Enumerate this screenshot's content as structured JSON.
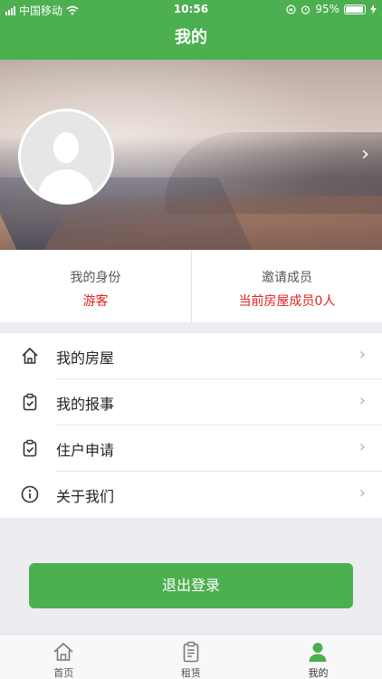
{
  "status_bar": {
    "carrier": "中国移动",
    "time": "10:56",
    "battery_percent": "95%",
    "battery_level": 0.95
  },
  "nav": {
    "title": "我的"
  },
  "identity": {
    "role_label": "我的身份",
    "role_value": "游客",
    "invite_label": "邀请成员",
    "invite_value": "当前房屋成员0人"
  },
  "menu": {
    "items": [
      {
        "label": "我的房屋",
        "icon": "home-icon"
      },
      {
        "label": "我的报事",
        "icon": "clipboard-check-icon"
      },
      {
        "label": "住户申请",
        "icon": "clipboard-check-icon"
      },
      {
        "label": "关于我们",
        "icon": "info-icon"
      }
    ]
  },
  "logout": {
    "label": "退出登录"
  },
  "tabbar": {
    "items": [
      {
        "label": "首页",
        "icon": "home-icon"
      },
      {
        "label": "租赁",
        "icon": "clipboard-icon"
      },
      {
        "label": "我的",
        "icon": "person-icon"
      }
    ],
    "active": "我的"
  },
  "colors": {
    "accent": "#4caf50",
    "highlight_text": "#e02020"
  }
}
